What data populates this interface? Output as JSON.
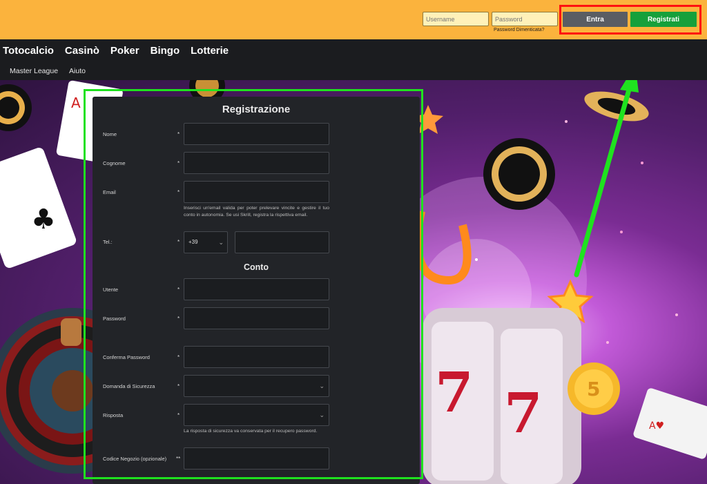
{
  "header": {
    "username_placeholder": "Username",
    "password_placeholder": "Password",
    "forgot_password": "Password Dimenticata?",
    "login_button": "Entra",
    "register_button": "Registrati"
  },
  "main_nav": [
    "Totocalcio",
    "Casinò",
    "Poker",
    "Bingo",
    "Lotterie"
  ],
  "sub_nav": [
    "Master League",
    "Aiuto"
  ],
  "form": {
    "title": "Registrazione",
    "section_account": "Conto",
    "labels": {
      "nome": "Nome",
      "cognome": "Cognome",
      "email": "Email",
      "tel": "Tel.:",
      "utente": "Utente",
      "password": "Password",
      "conferma_password": "Conferma Password",
      "domanda": "Domanda di Sicurezza",
      "risposta": "Risposta",
      "codice_negozio": "Codice Negozio (opzionale)"
    },
    "required_marker": "*",
    "optional_marker": "**",
    "email_help": "Inserisci un'email valida per poter prelevare vincite e gestire il tuo conto in autonomia. Se usi Skrill, registra la rispettiva email.",
    "risposta_help": "La risposta di sicurezza va conservata per il recupero password.",
    "phone_prefix": "+39"
  },
  "colors": {
    "header_bg": "#fbb33d",
    "nav_bg": "#1b1c1f",
    "panel_bg": "#222428",
    "login_button": "#5a5d63",
    "register_button": "#16a03b",
    "highlight_red": "#ff1010",
    "highlight_green": "#1fe21f",
    "arrow": "#1fe21f"
  },
  "icons": {
    "select_arrow": "chevron-down-icon",
    "annotation_arrow": "arrow-up-icon"
  }
}
